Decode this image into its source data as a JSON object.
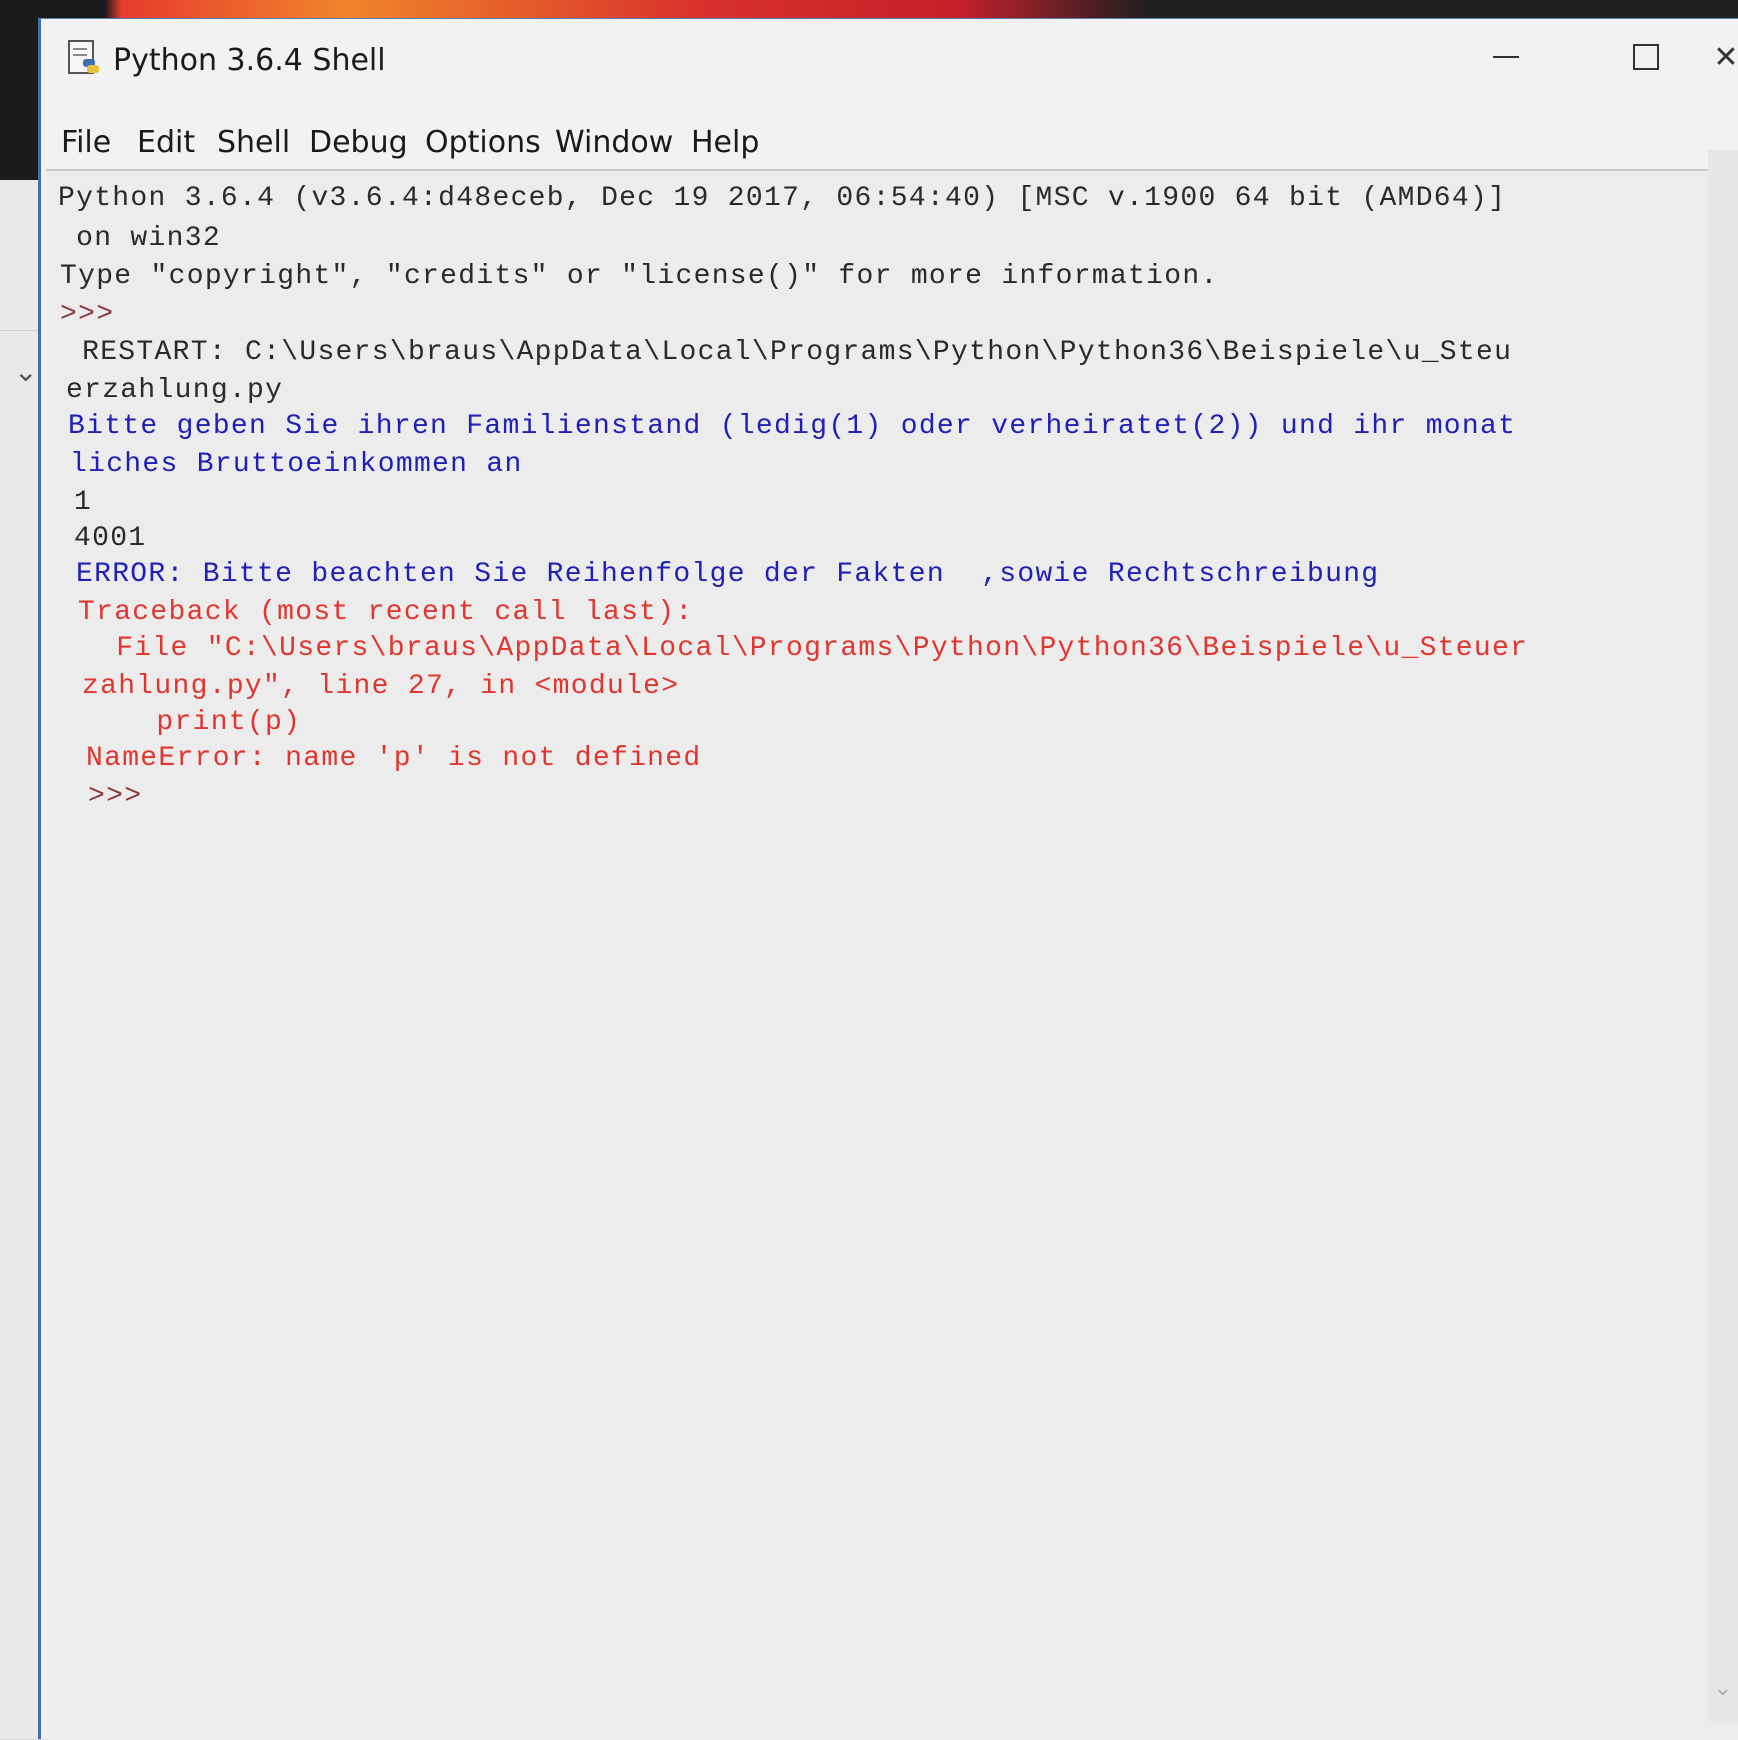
{
  "window": {
    "title": "Python 3.6.4 Shell",
    "controls": {
      "minimize": "minimize",
      "maximize": "maximize",
      "close": "✕"
    }
  },
  "menu": {
    "items": [
      "File",
      "Edit",
      "Shell",
      "Debug",
      "Options",
      "Window",
      "Help"
    ]
  },
  "shell": {
    "lines": [
      "Python 3.6.4 (v3.6.4:d48eceb, Dec 19 2017, 06:54:40) [MSC v.1900 64 bit (AMD64)]",
      " on win32",
      "Type \"copyright\", \"credits\" or \"license()\" for more information.",
      ">>> ",
      " RESTART: C:\\Users\\braus\\AppData\\Local\\Programs\\Python\\Python36\\Beispiele\\u_Steu",
      "erzahlung.py ",
      "Bitte geben Sie ihren Familienstand (ledig(1) oder verheiratet(2)) und ihr monat",
      "liches Bruttoeinkommen an",
      "1",
      "4001",
      "ERROR: Bitte beachten Sie Reihenfolge der Fakten  ,sowie Rechtschreibung",
      "Traceback (most recent call last):",
      "  File \"C:\\Users\\braus\\AppData\\Local\\Programs\\Python\\Python36\\Beispiele\\u_Steuer",
      "zahlung.py\", line 27, in <module>",
      "    print(p)",
      "NameError: name 'p' is not defined",
      ">>> "
    ]
  },
  "colors": {
    "stdout": "#2a2a2a",
    "prompt": "#8a3a3a",
    "program_output": "#2020b8",
    "error": "#e0362f"
  },
  "icons": {
    "app": "python-idle-icon",
    "collapse": "chevron-down-icon",
    "scroll_down": "scroll-down-arrow-icon"
  }
}
